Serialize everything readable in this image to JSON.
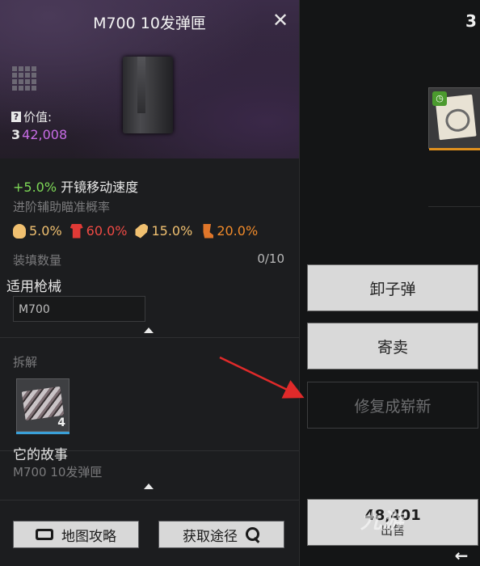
{
  "panel": {
    "title": "M700 10发弹匣",
    "close_icon": "close-icon",
    "value_label": "价值:",
    "value_coin": "3",
    "value_amount": "42,008",
    "stat_main_value": "+5.0%",
    "stat_main_text": "开镜移动速度",
    "stat_sub": "进阶辅助瞄准概率",
    "parts": [
      {
        "icon": "head-icon",
        "value": "5.0%"
      },
      {
        "icon": "chest-icon",
        "value": "60.0%"
      },
      {
        "icon": "arm-icon",
        "value": "15.0%"
      },
      {
        "icon": "leg-icon",
        "value": "20.0%"
      }
    ],
    "capacity_label": "装填数量",
    "capacity_value": "0/10",
    "weapons_title": "适用枪械",
    "weapon_name": "M700",
    "disassemble_label": "拆解",
    "disassemble_qty": "4",
    "story_title": "它的故事",
    "story_text": "M700 10发弹匣",
    "map_button": "地图攻略",
    "acquire_button": "获取途径"
  },
  "right": {
    "top_number": "3",
    "actions": [
      {
        "label": "卸子弹",
        "enabled": true
      },
      {
        "label": "寄卖",
        "enabled": true
      },
      {
        "label": "修复成崭新",
        "enabled": false
      }
    ],
    "sell_price": "48,401",
    "sell_label": "出售",
    "back_arrow": "←",
    "watermark": "九游"
  },
  "colors": {
    "accent_purple": "#c86ce6",
    "positive_green": "#7ed957",
    "chest_red": "#ef4a44",
    "annotation_arrow": "#e02a2a"
  }
}
